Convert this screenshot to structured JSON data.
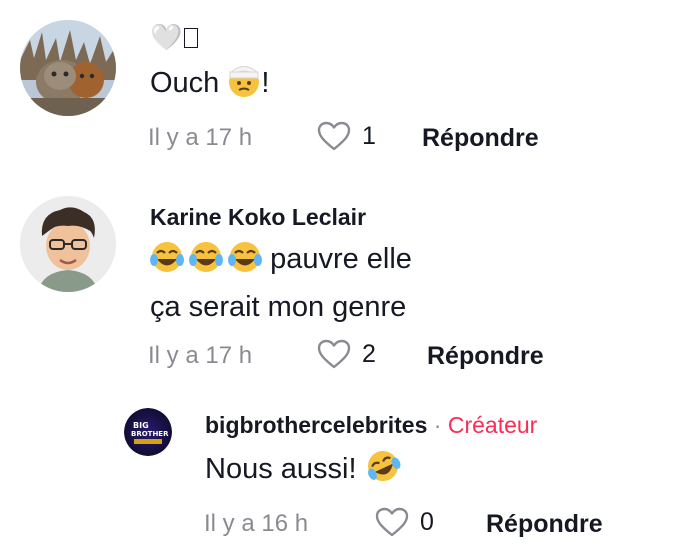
{
  "comments": [
    {
      "author": "",
      "header_symbol": "🤍",
      "text_word": "Ouch",
      "text_suffix": "!",
      "time": "Il y a 17 h",
      "likes": "1",
      "reply_label": "Répondre",
      "avatar_icon": "cat-photo-avatar",
      "emoji_icon": "bandaged-head-emoji"
    },
    {
      "author": "Karine Koko Leclair",
      "text_line1": "pauvre elle",
      "text_line2": "ça serait mon genre",
      "time": "Il y a 17 h",
      "likes": "2",
      "reply_label": "Répondre",
      "avatar_icon": "person-cartoon-avatar",
      "emoji_icon": "tears-of-joy-emoji"
    },
    {
      "author": "bigbrothercelebrites",
      "separator": "·",
      "badge": "Créateur",
      "text_word": "Nous aussi!",
      "time": "Il y a 16 h",
      "likes": "0",
      "reply_label": "Répondre",
      "avatar_icon": "big-brother-logo-avatar",
      "avatar_logo_text": "BIG BROTHER CÉLÉBRITÉS",
      "emoji_icon": "rofl-emoji"
    }
  ],
  "colors": {
    "creator": "#fe2c55",
    "meta": "#8a8b91",
    "text": "#161823"
  }
}
